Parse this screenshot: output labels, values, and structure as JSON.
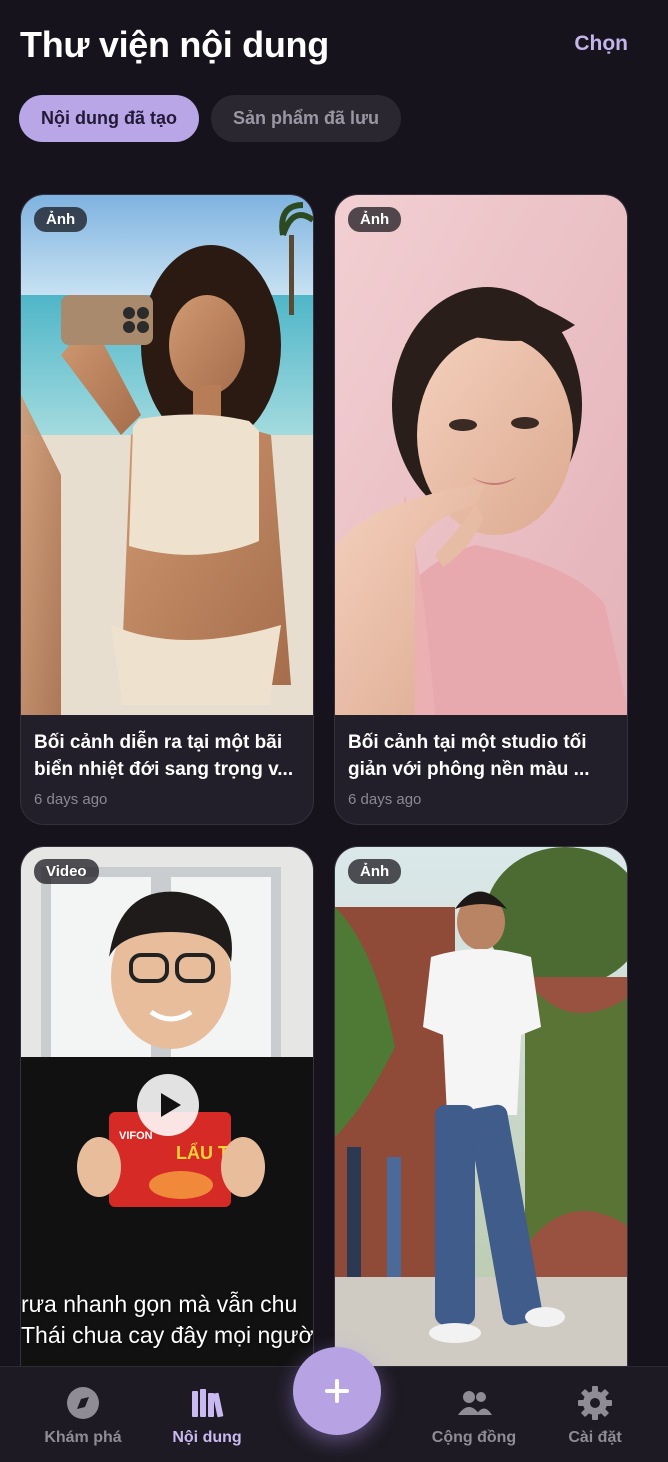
{
  "header": {
    "title": "Thư viện nội dung",
    "select_label": "Chọn"
  },
  "tabs": [
    {
      "label": "Nội dung đã tạo",
      "active": true
    },
    {
      "label": "Sản phẩm đã lưu",
      "active": false
    }
  ],
  "items": [
    {
      "badge": "Ảnh",
      "caption": "Bối cảnh diễn ra tại một bãi biển nhiệt đới sang trọng v...",
      "time": "6 days ago"
    },
    {
      "badge": "Ảnh",
      "caption": "Bối cảnh tại một studio tối giản với phông nền màu ...",
      "time": "6 days ago"
    },
    {
      "badge": "Video",
      "subtitle_line1": "rưa nhanh gọn mà vẫn chu",
      "subtitle_line2": "Thái chua cay đây mọi ngườ",
      "package_brand": "VIFON",
      "package_title": "LẨU THÁI"
    },
    {
      "badge": "Ảnh"
    }
  ],
  "nav": [
    {
      "label": "Khám phá",
      "icon": "compass-icon",
      "active": false
    },
    {
      "label": "Nội dung",
      "icon": "library-icon",
      "active": true
    },
    {
      "label": "Cộng đồng",
      "icon": "people-icon",
      "active": false
    },
    {
      "label": "Cài đặt",
      "icon": "gear-icon",
      "active": false
    }
  ],
  "fab_icon": "plus-icon",
  "colors": {
    "accent": "#b9a6e6",
    "background": "#16131c",
    "card": "#221f2a"
  }
}
